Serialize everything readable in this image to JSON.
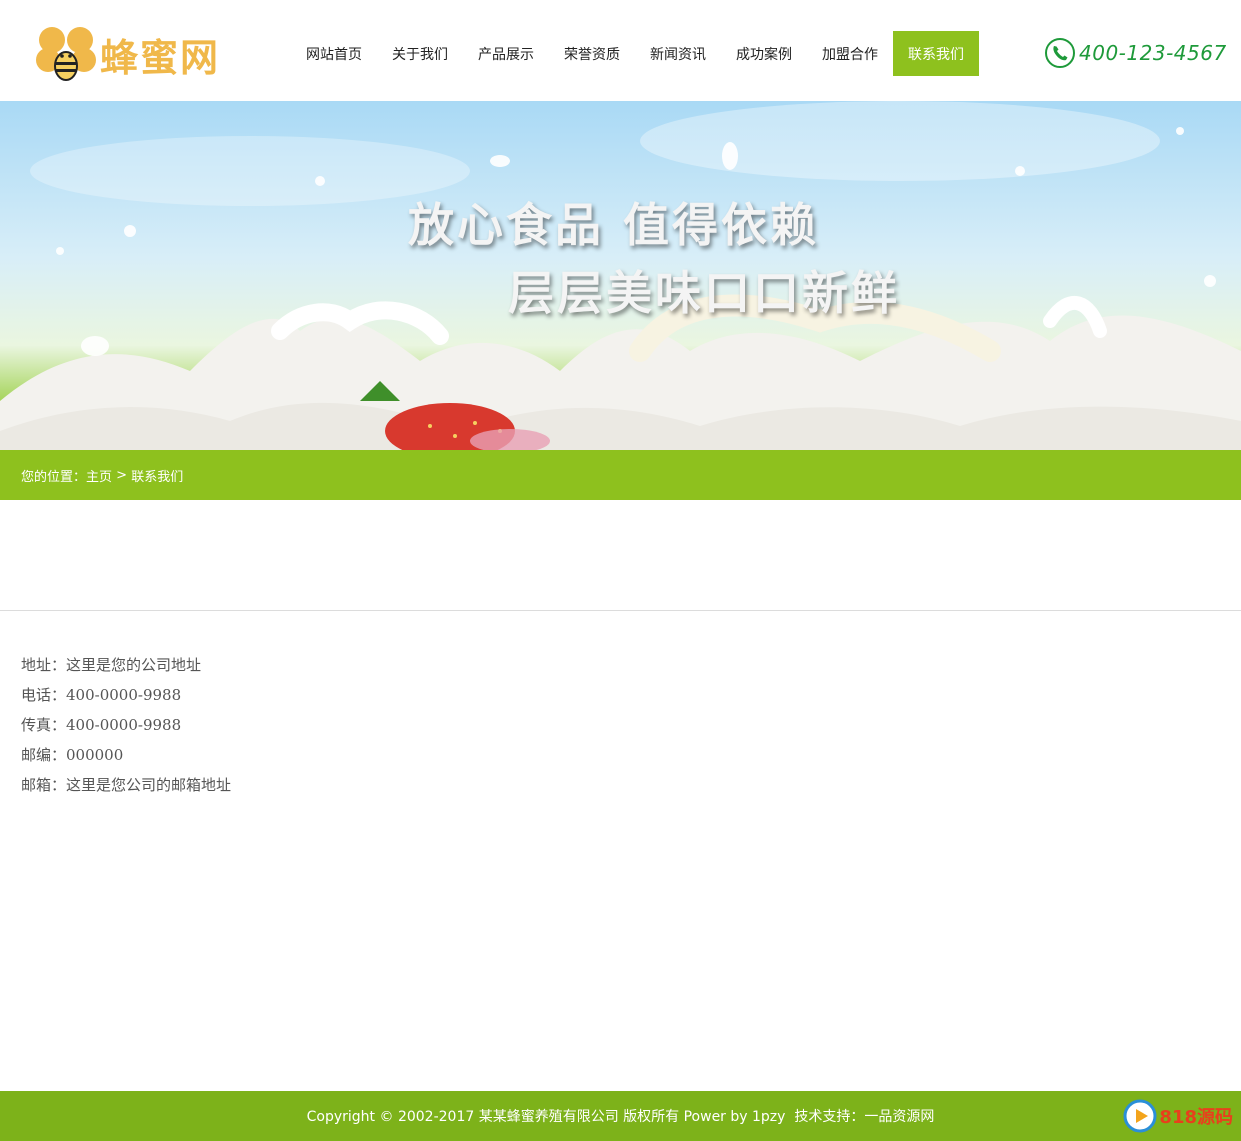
{
  "header": {
    "logo_text": "蜂蜜网",
    "nav": [
      {
        "label": "网站首页",
        "active": false
      },
      {
        "label": "关于我们",
        "active": false
      },
      {
        "label": "产品展示",
        "active": false
      },
      {
        "label": "荣誉资质",
        "active": false
      },
      {
        "label": "新闻资讯",
        "active": false
      },
      {
        "label": "成功案例",
        "active": false
      },
      {
        "label": "加盟合作",
        "active": false
      },
      {
        "label": "联系我们",
        "active": true
      }
    ],
    "phone": "400-123-4567"
  },
  "banner": {
    "slogan_line1": "放心食品 值得依赖",
    "slogan_line2": "层层美味口口新鲜"
  },
  "breadcrumb": {
    "prefix": "您的位置：",
    "home": "主页",
    "separator": " > ",
    "current": "联系我们"
  },
  "contact": {
    "rows": [
      "地址：这里是您的公司地址",
      "电话：400-0000-9988",
      "传真：400-0000-9988",
      "邮编：000000",
      "邮箱：这里是您公司的邮箱地址"
    ]
  },
  "footer": {
    "copyright": "Copyright © 2002-2017 某某蜂蜜养殖有限公司 版权所有 Power by 1pzy  技术支持：一品资源网"
  },
  "watermark": {
    "text": "818源码"
  },
  "colors": {
    "accent_green": "#8ec11e",
    "footer_green": "#7db21a",
    "logo_yellow": "#f0b84a",
    "phone_green": "#1e9a3a"
  }
}
